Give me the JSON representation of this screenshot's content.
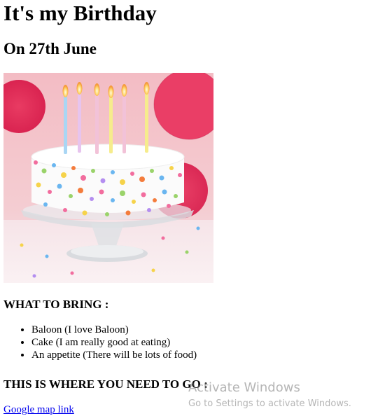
{
  "page": {
    "heading": "It's my Birthday",
    "subheading": "On 27th June"
  },
  "image": {
    "subject": "birthday-cake-with-candles"
  },
  "bring": {
    "heading": "WHAT TO BRING :",
    "items": [
      "Baloon (I love Baloon)",
      "Cake (I am really good at eating)",
      "An appetite (There will be lots of food)"
    ]
  },
  "location": {
    "heading": "THIS IS WHERE YOU NEED TO GO :",
    "link_text": "Google map link"
  },
  "watermark": {
    "title": "Activate Windows",
    "subtitle": "Go to Settings to activate Windows."
  },
  "colors": {
    "link": "#0000ee",
    "text": "#000000",
    "background": "#ffffff",
    "photo_background": "#f1b9c0"
  }
}
